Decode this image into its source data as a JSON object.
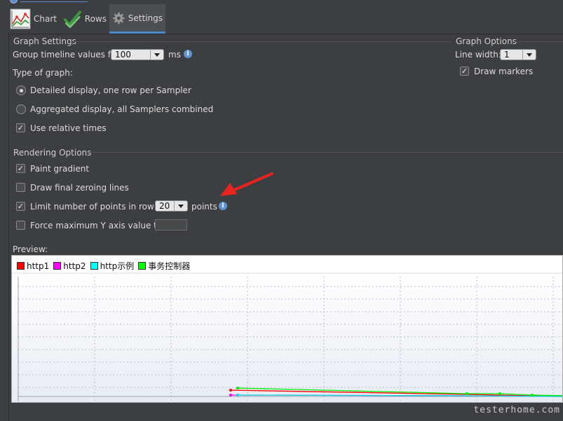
{
  "tabs": [
    {
      "label": "Chart",
      "icon": "line-chart-icon"
    },
    {
      "label": "Rows",
      "icon": "checkmarks-icon"
    },
    {
      "label": "Settings",
      "icon": "gear-icon"
    }
  ],
  "graph_settings": {
    "title": "Graph Settings",
    "group_label": "Group timeline values for",
    "group_value": "100",
    "group_unit": "ms",
    "type_label": "Type of graph:",
    "radio_detailed": "Detailed display, one row per Sampler",
    "radio_aggregated": "Aggregated display, all Samplers combined",
    "use_relative": "Use relative times"
  },
  "graph_options": {
    "title": "Graph Options",
    "line_width_label": "Line width:",
    "line_width_value": "1",
    "draw_markers": "Draw markers"
  },
  "rendering": {
    "title": "Rendering Options",
    "paint_gradient": "Paint gradient",
    "draw_zeroing": "Draw final zeroing lines",
    "limit_label": "Limit number of points in row to",
    "limit_value": "20",
    "limit_unit": "points",
    "force_max": "Force maximum Y axis value to"
  },
  "preview": {
    "label": "Preview:",
    "legend": [
      {
        "name": "http1",
        "color": "#ff0000"
      },
      {
        "name": "http2",
        "color": "#ff00ff"
      },
      {
        "name": "http示例",
        "color": "#00ffff"
      },
      {
        "name": "事务控制器",
        "color": "#00ff00"
      }
    ]
  },
  "watermark": "testerhome.com"
}
